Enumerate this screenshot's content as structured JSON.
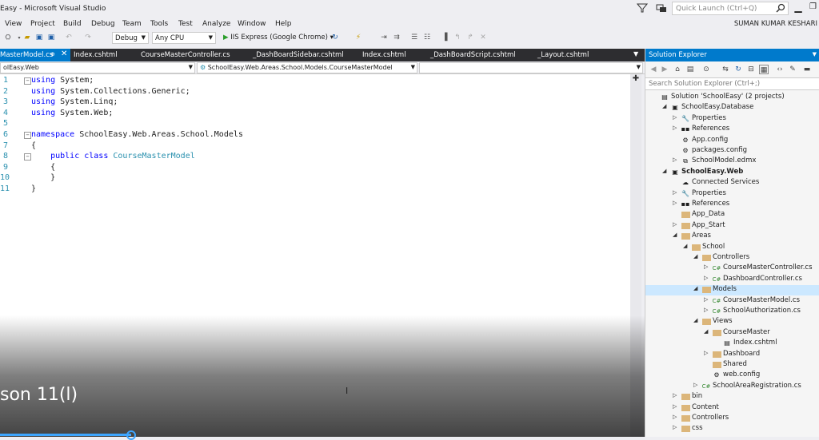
{
  "window": {
    "title": "Easy - Microsoft Visual Studio",
    "quick_launch_placeholder": "Quick Launch (Ctrl+Q)"
  },
  "menu": [
    "View",
    "Project",
    "Build",
    "Debug",
    "Team",
    "Tools",
    "Test",
    "Analyze",
    "Window",
    "Help"
  ],
  "user": "SUMAN KUMAR KESHARI",
  "toolbar": {
    "config": "Debug",
    "platform": "Any CPU",
    "run_label": "IIS Express (Google Chrome)"
  },
  "tabs": [
    {
      "label": "MasterModel.cs",
      "active": true
    },
    {
      "label": "Index.cshtml",
      "active": false
    },
    {
      "label": "CourseMasterController.cs",
      "active": false
    },
    {
      "label": "_DashBoardSidebar.cshtml",
      "active": false
    },
    {
      "label": "Index.cshtml",
      "active": false
    },
    {
      "label": "_DashBoardScript.cshtml",
      "active": false
    },
    {
      "label": "_Layout.cshtml",
      "active": false
    }
  ],
  "navbar": {
    "project": "olEasy.Web",
    "class": "SchoolEasy.Web.Areas.School.Models.CourseMasterModel",
    "member": ""
  },
  "code": [
    {
      "n": "1",
      "tokens": [
        {
          "k": "kw",
          "t": "using"
        },
        {
          "k": "",
          "t": " System;"
        }
      ]
    },
    {
      "n": "2",
      "tokens": [
        {
          "k": "kw",
          "t": "using"
        },
        {
          "k": "",
          "t": " System.Collections.Generic;"
        }
      ]
    },
    {
      "n": "3",
      "tokens": [
        {
          "k": "kw",
          "t": "using"
        },
        {
          "k": "",
          "t": " System.Linq;"
        }
      ]
    },
    {
      "n": "4",
      "tokens": [
        {
          "k": "kw",
          "t": "using"
        },
        {
          "k": "",
          "t": " System.Web;"
        }
      ]
    },
    {
      "n": "5",
      "tokens": []
    },
    {
      "n": "6",
      "tokens": [
        {
          "k": "kw",
          "t": "namespace"
        },
        {
          "k": "",
          "t": " SchoolEasy.Web.Areas.School.Models"
        }
      ]
    },
    {
      "n": "7",
      "tokens": [
        {
          "k": "",
          "t": "{"
        }
      ]
    },
    {
      "n": "8",
      "tokens": [
        {
          "k": "",
          "t": "    "
        },
        {
          "k": "kw",
          "t": "public"
        },
        {
          "k": "",
          "t": " "
        },
        {
          "k": "kw",
          "t": "class"
        },
        {
          "k": "",
          "t": " "
        },
        {
          "k": "ty",
          "t": "CourseMasterModel"
        }
      ]
    },
    {
      "n": "9",
      "tokens": [
        {
          "k": "",
          "t": "    {"
        }
      ]
    },
    {
      "n": "10",
      "tokens": [
        {
          "k": "",
          "t": "    }"
        }
      ]
    },
    {
      "n": "11",
      "tokens": [
        {
          "k": "",
          "t": "}"
        }
      ]
    }
  ],
  "overlay_text": "son 11(l)",
  "video_progress": 0.16,
  "solution_explorer": {
    "title": "Solution Explorer",
    "search_placeholder": "Search Solution Explorer (Ctrl+;)",
    "nodes": [
      {
        "label": "Solution 'SchoolEasy' (2 projects)",
        "icon": "solution-icon",
        "level": 0,
        "exp": "",
        "bold": false
      },
      {
        "label": "SchoolEasy.Database",
        "icon": "csproj-icon",
        "level": 1,
        "exp": "◢",
        "bold": false
      },
      {
        "label": "Properties",
        "icon": "wrench-icon",
        "level": 2,
        "exp": "▷",
        "bold": false
      },
      {
        "label": "References",
        "icon": "references-icon",
        "level": 2,
        "exp": "▷",
        "bold": false
      },
      {
        "label": "App.config",
        "icon": "config-icon",
        "level": 2,
        "exp": "",
        "bold": false
      },
      {
        "label": "packages.config",
        "icon": "config-icon",
        "level": 2,
        "exp": "",
        "bold": false
      },
      {
        "label": "SchoolModel.edmx",
        "icon": "edmx-icon",
        "level": 2,
        "exp": "▷",
        "bold": false
      },
      {
        "label": "SchoolEasy.Web",
        "icon": "webproj-icon",
        "level": 1,
        "exp": "◢",
        "bold": true
      },
      {
        "label": "Connected Services",
        "icon": "cloud-icon",
        "level": 2,
        "exp": "",
        "bold": false
      },
      {
        "label": "Properties",
        "icon": "wrench-icon",
        "level": 2,
        "exp": "▷",
        "bold": false
      },
      {
        "label": "References",
        "icon": "references-icon",
        "level": 2,
        "exp": "▷",
        "bold": false
      },
      {
        "label": "App_Data",
        "icon": "folder-icon",
        "level": 2,
        "exp": "",
        "bold": false
      },
      {
        "label": "App_Start",
        "icon": "folder-icon",
        "level": 2,
        "exp": "▷",
        "bold": false
      },
      {
        "label": "Areas",
        "icon": "folder-icon",
        "level": 2,
        "exp": "◢",
        "bold": false
      },
      {
        "label": "School",
        "icon": "folder-icon",
        "level": 3,
        "exp": "◢",
        "bold": false
      },
      {
        "label": "Controllers",
        "icon": "folder-icon",
        "level": 4,
        "exp": "◢",
        "bold": false
      },
      {
        "label": "CourseMasterController.cs",
        "icon": "cs-file-icon",
        "level": 5,
        "exp": "▷",
        "bold": false
      },
      {
        "label": "DashboardController.cs",
        "icon": "cs-file-icon",
        "level": 5,
        "exp": "▷",
        "bold": false
      },
      {
        "label": "Models",
        "icon": "folder-icon",
        "level": 4,
        "exp": "◢",
        "bold": false,
        "selected": true
      },
      {
        "label": "CourseMasterModel.cs",
        "icon": "cs-file-icon",
        "level": 5,
        "exp": "▷",
        "bold": false
      },
      {
        "label": "SchoolAuthorization.cs",
        "icon": "cs-file-icon",
        "level": 5,
        "exp": "▷",
        "bold": false
      },
      {
        "label": "Views",
        "icon": "folder-icon",
        "level": 4,
        "exp": "◢",
        "bold": false
      },
      {
        "label": "CourseMaster",
        "icon": "folder-icon",
        "level": 5,
        "exp": "◢",
        "bold": false
      },
      {
        "label": "Index.cshtml",
        "icon": "cshtml-icon",
        "level": 6,
        "exp": "",
        "bold": false
      },
      {
        "label": "Dashboard",
        "icon": "folder-icon",
        "level": 5,
        "exp": "▷",
        "bold": false
      },
      {
        "label": "Shared",
        "icon": "folder-icon",
        "level": 5,
        "exp": "",
        "bold": false
      },
      {
        "label": "web.config",
        "icon": "config-icon",
        "level": 5,
        "exp": "",
        "bold": false
      },
      {
        "label": "SchoolAreaRegistration.cs",
        "icon": "cs-file-icon",
        "level": 4,
        "exp": "▷",
        "bold": false
      },
      {
        "label": "bin",
        "icon": "folder-icon",
        "level": 2,
        "exp": "▷",
        "bold": false
      },
      {
        "label": "Content",
        "icon": "folder-icon",
        "level": 2,
        "exp": "▷",
        "bold": false
      },
      {
        "label": "Controllers",
        "icon": "folder-icon",
        "level": 2,
        "exp": "▷",
        "bold": false
      },
      {
        "label": "css",
        "icon": "folder-icon",
        "level": 2,
        "exp": "▷",
        "bold": false
      }
    ]
  }
}
